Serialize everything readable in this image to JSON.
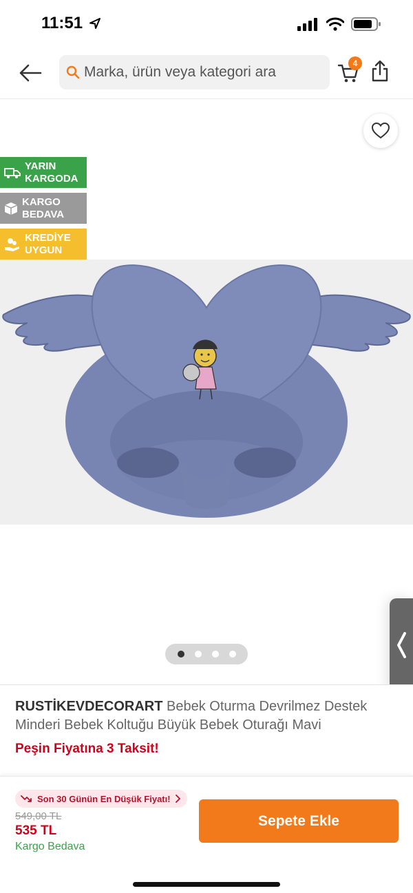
{
  "status_bar": {
    "time": "11:51"
  },
  "header": {
    "search_placeholder": "Marka, ürün veya kategori ara",
    "cart_count": "4"
  },
  "badges": [
    {
      "label": "YARIN KARGODA",
      "color": "#3aa34a",
      "icon": "truck-icon"
    },
    {
      "label": "KARGO BEDAVA",
      "color": "#9a9a9a",
      "icon": "box-icon"
    },
    {
      "label": "KREDİYE UYGUN",
      "color": "#f5be2c",
      "icon": "coins-hand-icon"
    }
  ],
  "gallery": {
    "image_count": 4,
    "active_index": 0
  },
  "product": {
    "brand": "RUSTİKEVDECORART",
    "name": "Bebek Oturma Devrilmez Destek Minderi Bebek Koltuğu Büyük Bebek Oturağı Mavi",
    "installment_text": "Peşin Fiyatına 3 Taksit!"
  },
  "purchase": {
    "lowest_price_label": "Son 30 Günün En Düşük Fiyatı!",
    "old_price": "549,00 TL",
    "price": "535 TL",
    "shipping": "Kargo Bedava",
    "add_to_cart": "Sepete Ekle"
  },
  "colors": {
    "accent": "#f27a1a",
    "sale_red": "#d0021b",
    "green": "#3aa34a"
  }
}
